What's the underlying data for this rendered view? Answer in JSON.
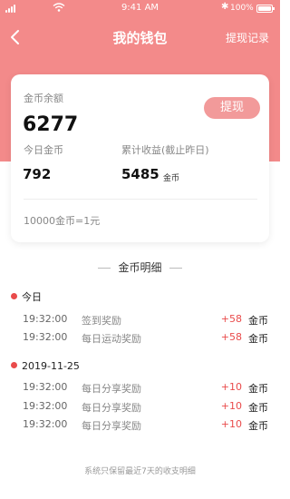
{
  "status_bar": {
    "time": "9:41 AM",
    "battery_text": "100%",
    "bluetooth_icon": "bluetooth-icon",
    "signal_icon": "signal-icon",
    "wifi_icon": "wifi-icon",
    "battery_icon": "battery-icon"
  },
  "nav": {
    "title": "我的钱包",
    "records_label": "提现记录",
    "back_icon": "chevron-left-icon"
  },
  "card": {
    "balance_label": "金币余额",
    "balance_value": "6277",
    "withdraw_label": "提现",
    "today_label": "今日金币",
    "today_value": "792",
    "total_label": "累计收益(截止昨日)",
    "total_value": "5485",
    "total_unit": "金币",
    "rate_text": "10000金币=1元"
  },
  "details": {
    "title": "金币明细",
    "groups": [
      {
        "label": "今日",
        "items": [
          {
            "time": "19:32:00",
            "desc": "签到奖励",
            "amount": "+58",
            "unit": "金币"
          },
          {
            "time": "19:32:00",
            "desc": "每日运动奖励",
            "amount": "+58",
            "unit": "金币"
          }
        ]
      },
      {
        "label": "2019-11-25",
        "items": [
          {
            "time": "19:32:00",
            "desc": "每日分享奖励",
            "amount": "+10",
            "unit": "金币"
          },
          {
            "time": "19:32:00",
            "desc": "每日分享奖励",
            "amount": "+10",
            "unit": "金币"
          },
          {
            "time": "19:32:00",
            "desc": "每日分享奖励",
            "amount": "+10",
            "unit": "金币"
          }
        ]
      }
    ],
    "footer_note": "系统只保留最近7天的收支明细"
  },
  "colors": {
    "header": "#f38a8a",
    "withdraw_button": "#f29a9a",
    "accent_red": "#e94b4b"
  }
}
